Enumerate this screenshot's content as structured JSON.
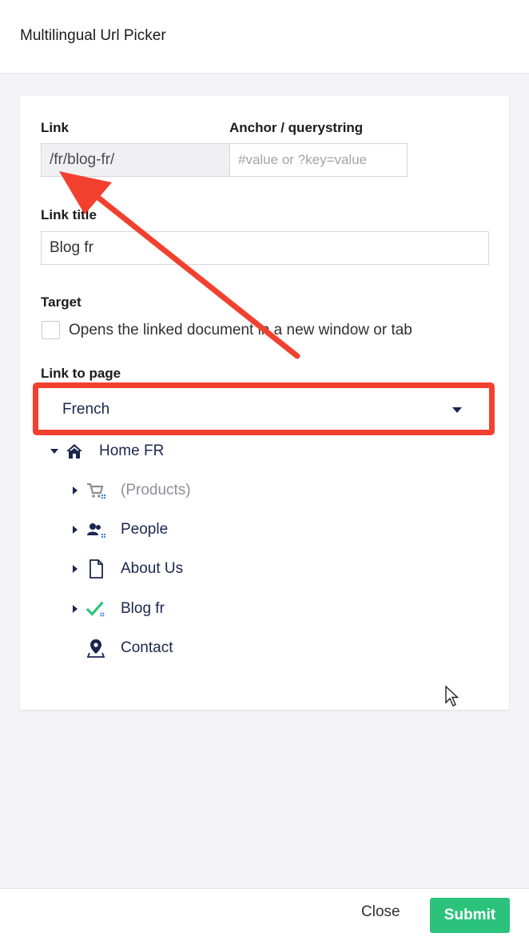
{
  "dialog": {
    "title": "Multilingual Url Picker"
  },
  "form": {
    "link_label": "Link",
    "link_value": "/fr/blog-fr/",
    "anchor_label": "Anchor / querystring",
    "anchor_placeholder": "#value or ?key=value",
    "link_title_label": "Link title",
    "link_title_value": "Blog fr",
    "target_label": "Target",
    "target_option": "Opens the linked document in a new window or tab",
    "target_checked": false,
    "link_to_page_label": "Link to page",
    "language_selected": "French"
  },
  "tree": {
    "root": {
      "label": "Home FR",
      "icon": "home-icon",
      "expanded": true
    },
    "children": [
      {
        "label": "(Products)",
        "icon": "cart-icon",
        "unpublished": true,
        "has_children": true
      },
      {
        "label": "People",
        "icon": "people-icon",
        "has_children": true
      },
      {
        "label": "About Us",
        "icon": "document-icon",
        "has_children": true
      },
      {
        "label": "Blog fr",
        "icon": "check-icon",
        "selected": true,
        "has_children": true
      },
      {
        "label": "Contact",
        "icon": "map-pin-icon",
        "has_children": false
      }
    ]
  },
  "footer": {
    "close_label": "Close",
    "submit_label": "Submit"
  },
  "colors": {
    "accent_red": "#f2402f",
    "submit_green": "#2bc37c",
    "navy": "#1b264f",
    "check_green": "#2bc37c"
  }
}
